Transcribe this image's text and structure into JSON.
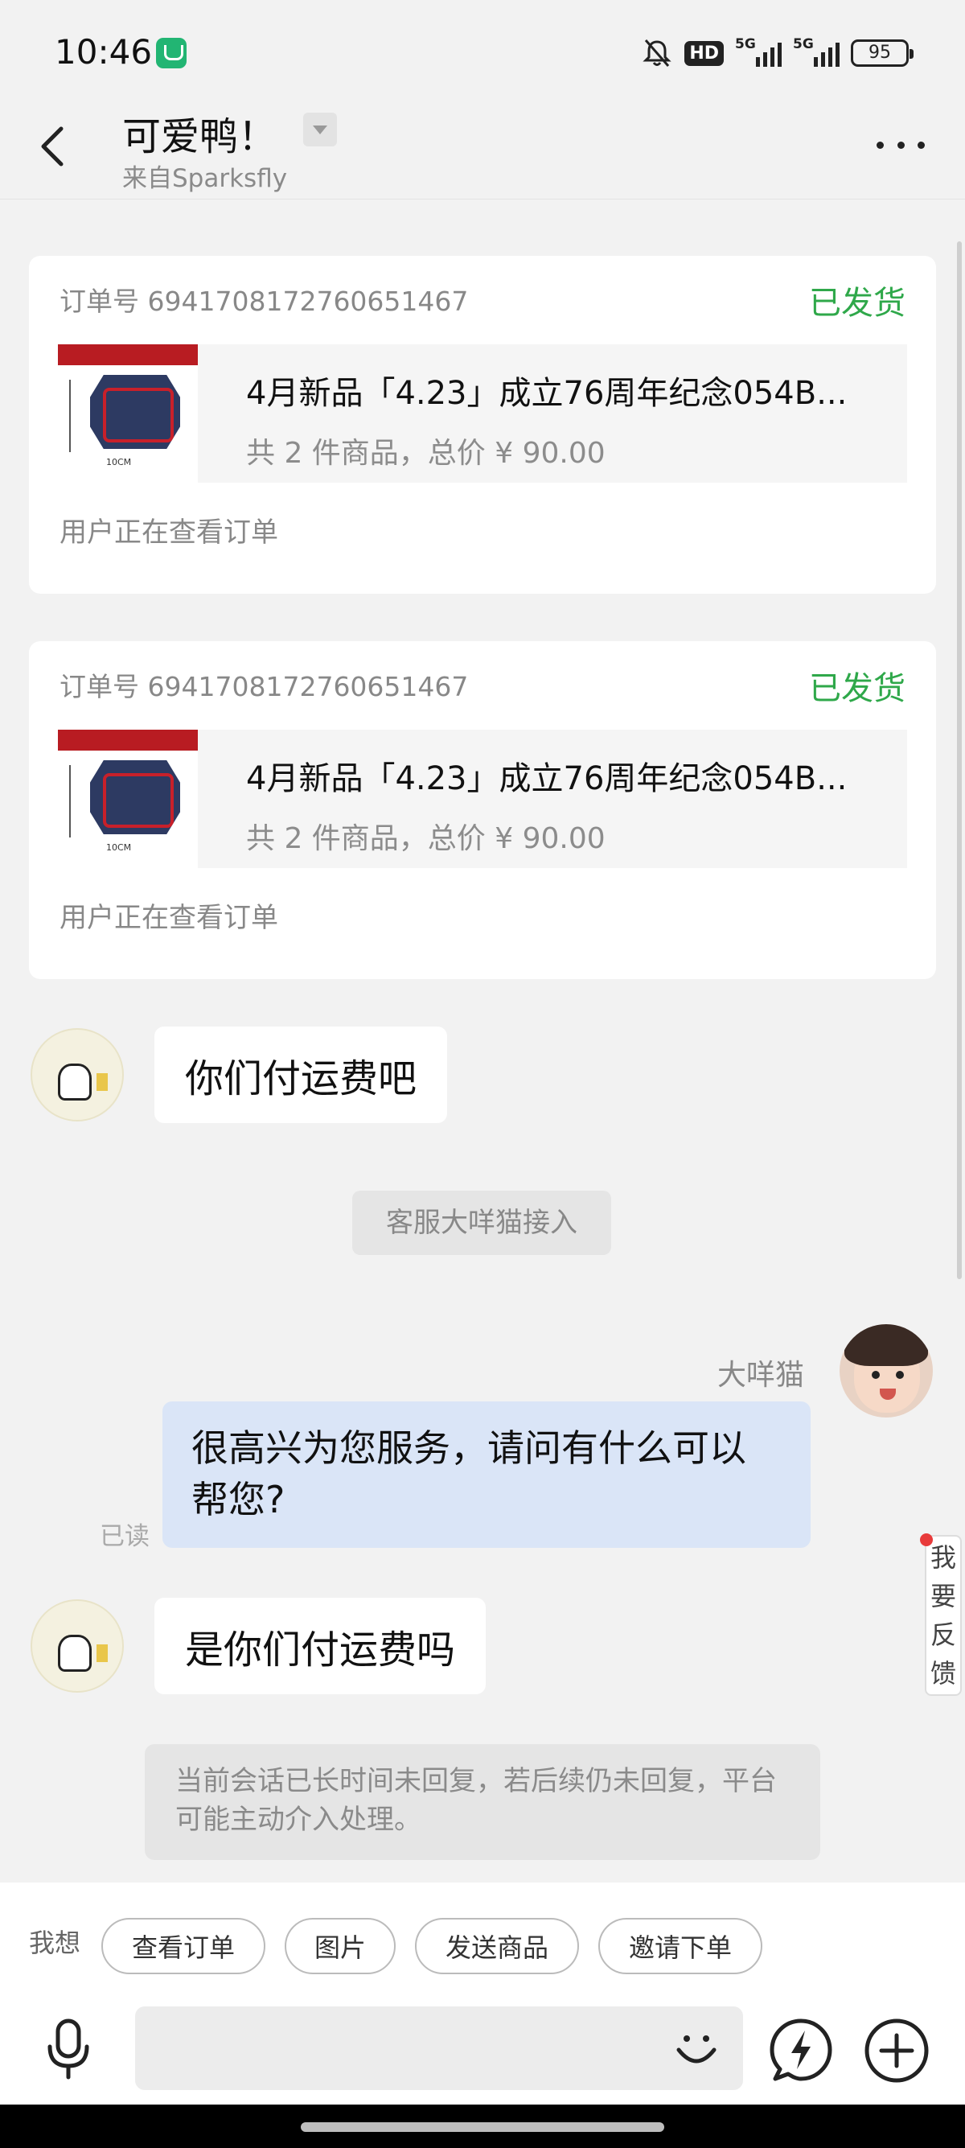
{
  "status_bar": {
    "time": "10:46",
    "hd_label": "HD",
    "network_1": "5G",
    "network_2": "5G",
    "battery": "95"
  },
  "header": {
    "title": "可爱鸭！",
    "subtitle": "来自Sparksfly"
  },
  "orders": [
    {
      "number": "订单号 6941708172760651467",
      "status": "已发货",
      "product_title": "4月新品「4.23」成立76周年纪念054B...",
      "product_meta": "共 2 件商品，总价 ¥ 90.00",
      "footer": "用户正在查看订单"
    },
    {
      "number": "订单号 6941708172760651467",
      "status": "已发货",
      "product_title": "4月新品「4.23」成立76周年纪念054B...",
      "product_meta": "共 2 件商品，总价 ¥ 90.00",
      "footer": "用户正在查看订单"
    }
  ],
  "messages": {
    "customer_1": "你们付运费吧",
    "system_join": "客服大咩猫接入",
    "agent_name": "大咩猫",
    "agent_reply": "很高兴为您服务，请问有什么可以帮您?",
    "read_status": "已读",
    "customer_2": "是你们付运费吗",
    "system_notice": "当前会话已长时间未回复，若后续仍未回复，平台可能主动介入处理。"
  },
  "feedback_label": "我要反馈",
  "quick_replies": {
    "label": "我想",
    "items": [
      "查看订单",
      "图片",
      "发送商品",
      "邀请下单"
    ]
  },
  "input": {
    "placeholder": ""
  },
  "colors": {
    "status_green": "#2fa84a",
    "agent_bubble": "#dae5f7",
    "notification_dot": "#e83a3a"
  },
  "icons": [
    "back-icon",
    "more-icon",
    "mic-icon",
    "emoji-icon",
    "bolt-icon",
    "plus-icon",
    "mute-bell-icon"
  ]
}
